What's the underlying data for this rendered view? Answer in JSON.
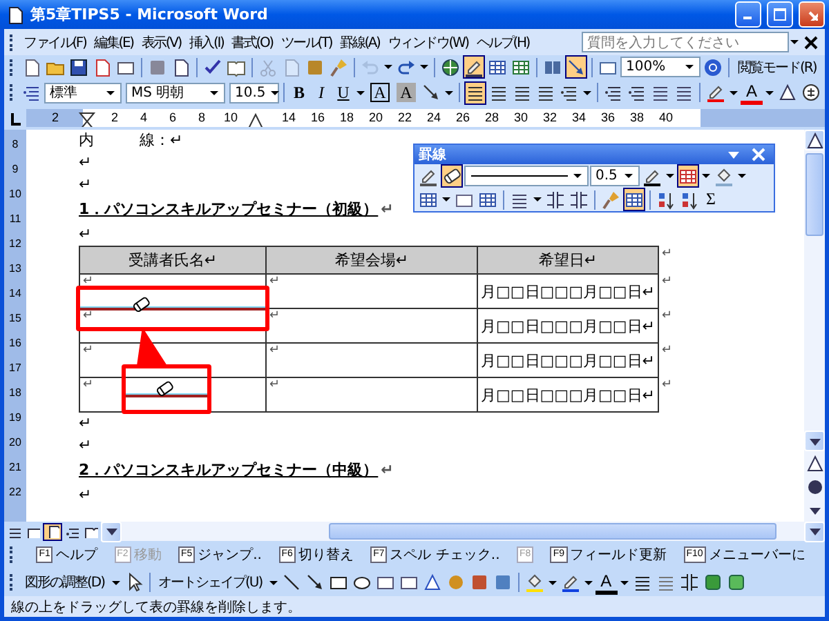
{
  "window": {
    "title": "第5章TIPS5 - Microsoft Word"
  },
  "menu": {
    "items": [
      "ファイル(F)",
      "編集(E)",
      "表示(V)",
      "挿入(I)",
      "書式(O)",
      "ツール(T)",
      "罫線(A)",
      "ウィンドウ(W)",
      "ヘルプ(H)"
    ],
    "help_search": {
      "placeholder": "質問を入力してください"
    }
  },
  "standard_toolbar": {
    "tables_borders_on": true,
    "drawing_on": true,
    "zoom": "100%",
    "reading_mode": "閲覧モード(R)"
  },
  "formatting_toolbar": {
    "style": "標準",
    "font": "MS 明朝",
    "size": "10.5",
    "buttons": [
      {
        "kind": "bold",
        "label": "B"
      },
      {
        "kind": "italic",
        "label": "I"
      },
      {
        "kind": "underline",
        "label": "U"
      },
      {
        "kind": "boxed",
        "label": "A"
      },
      {
        "kind": "shaded",
        "label": "A"
      }
    ],
    "alignment": [
      {
        "selected": true
      },
      {
        "selected": false
      },
      {
        "selected": false
      },
      {
        "selected": false
      }
    ],
    "font_color": "A"
  },
  "ruler": {
    "numbers": [
      "2",
      "2",
      "4",
      "6",
      "8",
      "10",
      "14",
      "16",
      "18",
      "20",
      "22",
      "24",
      "26",
      "28",
      "30",
      "32",
      "34",
      "36",
      "38",
      "40"
    ],
    "side_numbers": [
      "8",
      "9",
      "10",
      "11",
      "12",
      "13",
      "14",
      "15",
      "16",
      "17",
      "18",
      "19",
      "20",
      "21",
      "22"
    ]
  },
  "document": {
    "blocks": [
      {
        "kind": "para",
        "text": "内　　　線：↵"
      },
      {
        "kind": "para",
        "text": "↵"
      },
      {
        "kind": "para",
        "text": "↵"
      },
      {
        "kind": "heading",
        "text": "1．パソコンスキルアップセミナー（初級）",
        "end_mark": "↵"
      },
      {
        "kind": "para",
        "text": "↵"
      },
      {
        "kind": "table",
        "columns": [
          "受講者氏名↵",
          "希望会場↵",
          "希望日↵"
        ],
        "header_end_mark": "↵",
        "rows": [
          {
            "cells": [
              "↵",
              "↵",
              "月□□日□□□月□□日↵"
            ],
            "end_mark": "↵"
          },
          {
            "cells": [
              "↵",
              "↵",
              "月□□日□□□月□□日↵"
            ],
            "end_mark": "↵"
          },
          {
            "cells": [
              "↵",
              "↵",
              "月□□日□□□月□□日↵"
            ],
            "end_mark": "↵"
          },
          {
            "cells": [
              "↵",
              "↵",
              "月□□日□□□月□□日↵"
            ],
            "end_mark": "↵"
          }
        ]
      },
      {
        "kind": "para",
        "text": "↵"
      },
      {
        "kind": "para",
        "text": "↵"
      },
      {
        "kind": "heading",
        "text": "2．パソコンスキルアップセミナー（中級）",
        "end_mark": "↵"
      },
      {
        "kind": "para",
        "text": "↵"
      }
    ]
  },
  "borders_toolbar": {
    "title": "罫線",
    "draw_selected": false,
    "eraser_selected": true,
    "line_weight": "0.5",
    "outside_border_selected": true,
    "table_grid_selected": true,
    "autosum": "Σ"
  },
  "view_buttons": [
    {
      "selected": false
    },
    {
      "selected": false
    },
    {
      "selected": true
    },
    {
      "selected": false
    },
    {
      "selected": false
    }
  ],
  "function_keys": [
    {
      "key": "F1",
      "label": "ヘルプ",
      "disabled": false
    },
    {
      "key": "F2",
      "label": "移動",
      "disabled": true
    },
    {
      "key": "F5",
      "label": "ジャンプ..",
      "disabled": false
    },
    {
      "key": "F6",
      "label": "切り替え",
      "disabled": false
    },
    {
      "key": "F7",
      "label": "スペル チェック..",
      "disabled": false
    },
    {
      "key": "F8",
      "disabled": true
    },
    {
      "key": "F9",
      "label": "フィールド更新",
      "disabled": false
    },
    {
      "key": "F10",
      "label": "メニューバーに",
      "disabled": false
    }
  ],
  "drawing_toolbar": {
    "adjust": "図形の調整(D)",
    "autoshapes": "オートシェイプ(U)",
    "font_color": "A"
  },
  "status_bar": {
    "text": "線の上をドラッグして表の罫線を削除します。"
  }
}
